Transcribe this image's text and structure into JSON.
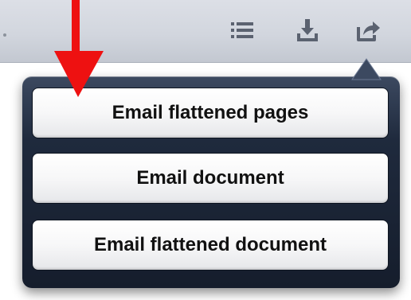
{
  "toolbar": {
    "icons": [
      "list-icon",
      "download-icon",
      "share-icon"
    ]
  },
  "annotation": {
    "arrow_color": "#ee0000"
  },
  "popover": {
    "items": [
      {
        "label": "Email flattened pages"
      },
      {
        "label": "Email document"
      },
      {
        "label": "Email flattened document"
      }
    ]
  }
}
